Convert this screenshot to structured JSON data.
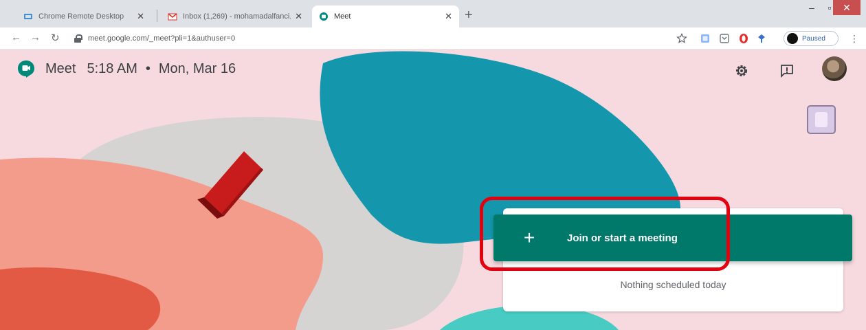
{
  "browser": {
    "tabs": [
      {
        "title": "Chrome Remote Desktop",
        "icon": "remote-desktop-favicon"
      },
      {
        "title": "Inbox (1,269) - mohamadalfanci...",
        "icon": "gmail-favicon"
      },
      {
        "title": "Meet",
        "icon": "meet-favicon",
        "active": true
      }
    ],
    "new_tab_label": "+",
    "window_controls": {
      "minimize": "–",
      "maximize": "▫",
      "close": "✕"
    },
    "url": "meet.google.com/_meet?pli=1&authuser=0",
    "profile_status": "Paused",
    "menu": "⋮"
  },
  "meet": {
    "brand": "Meet",
    "time": "5:18 AM",
    "separator": "•",
    "date": "Mon, Mar 16",
    "join_button": {
      "icon": "+",
      "label": "Join or start a meeting"
    },
    "schedule_empty": "Nothing scheduled today"
  },
  "colors": {
    "page_bg": "#f7dadf",
    "accent_green": "#00796b",
    "highlight": "#e3000f",
    "blob_teal": "#1497ad"
  }
}
